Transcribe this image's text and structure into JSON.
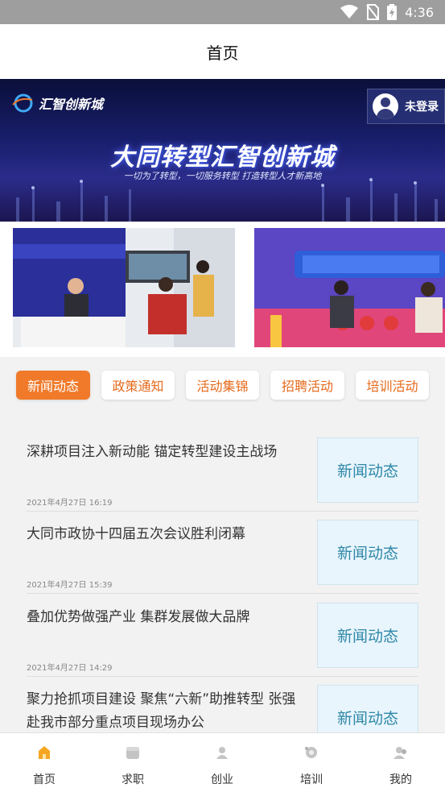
{
  "status_bar": {
    "time": "4:36",
    "icons": [
      "wifi-icon",
      "no-sim-icon",
      "battery-charging-icon"
    ]
  },
  "header": {
    "title": "首页"
  },
  "banner": {
    "logo_text": "汇智创新城",
    "login_label": "未登录",
    "headline": "大同转型汇智创新城",
    "subline": "一切为了转型，一切服务转型 打造转型人才新高地"
  },
  "categories": [
    {
      "label": "新闻动态",
      "active": true
    },
    {
      "label": "政策通知",
      "active": false
    },
    {
      "label": "活动集锦",
      "active": false
    },
    {
      "label": "招聘活动",
      "active": false
    },
    {
      "label": "培训活动",
      "active": false
    }
  ],
  "news": [
    {
      "title": "深耕项目注入新动能 锚定转型建设主战场",
      "time": "2021年4月27日 16:19",
      "tag": "新闻动态"
    },
    {
      "title": "大同市政协十四届五次会议胜利闭幕",
      "time": "2021年4月27日 15:39",
      "tag": "新闻动态"
    },
    {
      "title": "叠加优势做强产业 集群发展做大品牌",
      "time": "2021年4月27日 14:29",
      "tag": "新闻动态"
    },
    {
      "title": "聚力抢抓项目建设 聚焦“六新”助推转型 张强赴我市部分重点项目现场办公",
      "time": "",
      "tag": "新闻动态"
    }
  ],
  "tabs": [
    {
      "label": "首页",
      "icon": "home-icon",
      "active": true,
      "color": "#f5a623"
    },
    {
      "label": "求职",
      "icon": "job-icon",
      "active": false,
      "color": "#bdbdbd"
    },
    {
      "label": "创业",
      "icon": "startup-icon",
      "active": false,
      "color": "#bdbdbd"
    },
    {
      "label": "培训",
      "icon": "training-icon",
      "active": false,
      "color": "#bdbdbd"
    },
    {
      "label": "我的",
      "icon": "profile-icon",
      "active": false,
      "color": "#bdbdbd"
    }
  ],
  "colors": {
    "accent": "#f07a2a",
    "tag_text": "#2f88a8",
    "tag_bg": "#e9f5fc"
  }
}
